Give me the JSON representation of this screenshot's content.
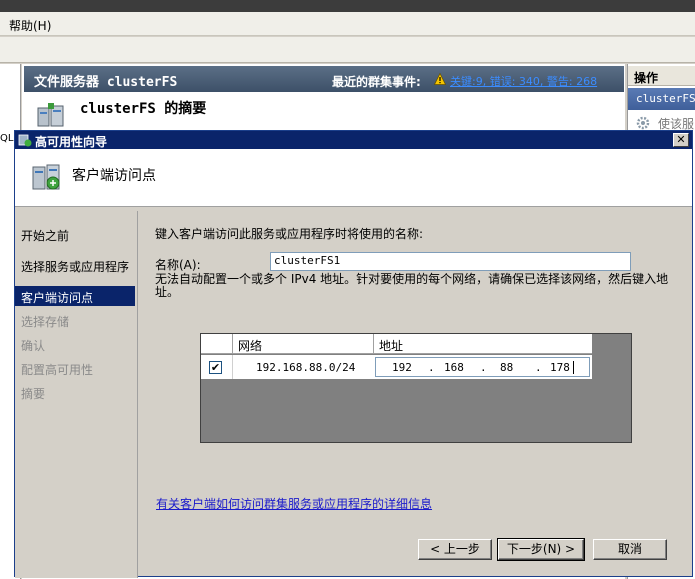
{
  "background_window": {
    "menu": {
      "help": "帮助(H)"
    },
    "left_pane_fragment": "QL",
    "header": {
      "title": "文件服务器 clusterFS",
      "events_label": "最近的群集事件:",
      "events_link": "关键:9, 错误: 340, 警告: 268"
    },
    "summary_title": "clusterFS 的摘要",
    "actions": {
      "title": "操作",
      "selected": "clusterFS",
      "item": "使该服"
    }
  },
  "dialog": {
    "title": "高可用性向导",
    "close_symbol": "✕",
    "heading": "客户端访问点",
    "nav": [
      {
        "label": "开始之前",
        "state": "normal"
      },
      {
        "label": "选择服务或应用程序",
        "state": "normal"
      },
      {
        "label": "客户端访问点",
        "state": "selected"
      },
      {
        "label": "选择存储",
        "state": "disabled"
      },
      {
        "label": "确认",
        "state": "disabled"
      },
      {
        "label": "配置高可用性",
        "state": "disabled"
      },
      {
        "label": "摘要",
        "state": "disabled"
      }
    ],
    "instruction": "键入客户端访问此服务或应用程序时将使用的名称:",
    "name_label": "名称(A):",
    "name_value": "clusterFS1",
    "note": "无法自动配置一个或多个 IPv4 地址。针对要使用的每个网络，请确保已选择该网络，然后键入地址。",
    "network_table": {
      "columns": [
        "网络",
        "地址"
      ],
      "rows": [
        {
          "checked": true,
          "check_symbol": "✔",
          "network": "192.168.88.0/24",
          "address": [
            "192",
            "168",
            "88",
            "178"
          ]
        }
      ]
    },
    "help_link": "有关客户端如何访问群集服务或应用程序的详细信息",
    "buttons": {
      "back": "< 上一步",
      "next": "下一步(N) >",
      "cancel": "取消"
    }
  },
  "colors": {
    "title_bar": "#0a246a",
    "nav_selected": "#0a246a",
    "dialog_face": "#d4d0c8",
    "link": "#1a1acb",
    "grid_background": "#808080"
  }
}
